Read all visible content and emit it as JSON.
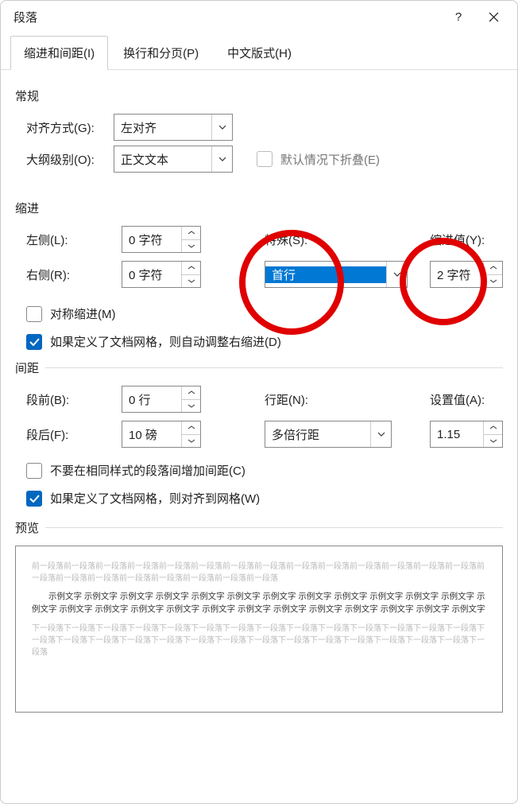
{
  "window": {
    "title": "段落",
    "help": "?",
    "close": "×"
  },
  "tabs": {
    "indent_spacing": "缩进和间距(I)",
    "line_page_breaks": "换行和分页(P)",
    "chinese_typo": "中文版式(H)"
  },
  "general": {
    "heading": "常规",
    "alignment_label": "对齐方式(G):",
    "alignment_value": "左对齐",
    "outline_label": "大纲级别(O):",
    "outline_value": "正文文本",
    "collapse_label": "默认情况下折叠(E)"
  },
  "indent": {
    "heading": "缩进",
    "left_label": "左侧(L):",
    "left_value": "0 字符",
    "right_label": "右侧(R):",
    "right_value": "0 字符",
    "special_label": "特殊(S):",
    "special_value": "首行",
    "by_label": "缩进值(Y):",
    "by_value": "2 字符",
    "mirror_label": "对称缩进(M)",
    "grid_label": "如果定义了文档网格，则自动调整右缩进(D)"
  },
  "spacing": {
    "heading": "间距",
    "before_label": "段前(B):",
    "before_value": "0 行",
    "after_label": "段后(F):",
    "after_value": "10 磅",
    "line_spacing_label": "行距(N):",
    "line_spacing_value": "多倍行距",
    "at_label": "设置值(A):",
    "at_value": "1.15",
    "dont_add_label": "不要在相同样式的段落间增加间距(C)",
    "snap_grid_label": "如果定义了文档网格，则对齐到网格(W)"
  },
  "preview": {
    "heading": "预览",
    "prev_para": "前一段落前一段落前一段落前一段落前一段落前一段落前一段落前一段落前一段落前一段落前一段落前一段落前一段落前一段落前一段落前一段落前一段落前一段落前一段落前一段落前一段落前一段落",
    "sample": "示例文字 示例文字 示例文字 示例文字 示例文字 示例文字 示例文字 示例文字 示例文字 示例文字 示例文字 示例文字 示例文字 示例文字 示例文字 示例文字 示例文字 示例文字 示例文字 示例文字 示例文字 示例文字 示例文字 示例文字 示例文字",
    "next_para": "下一段落下一段落下一段落下一段落下一段落下一段落下一段落下一段落下一段落下一段落下一段落下一段落下一段落下一段落下一段落下一段落下一段落下一段落下一段落下一段落下一段落下一段落下一段落下一段落下一段落下一段落下一段落下一段落下一段落"
  }
}
